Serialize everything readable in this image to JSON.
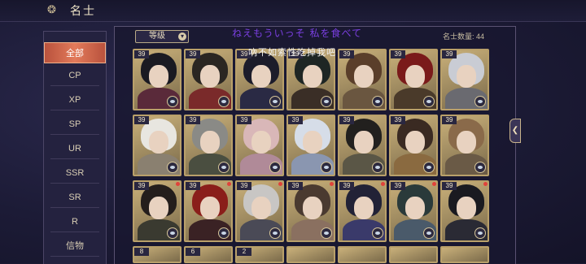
{
  "header": {
    "title": "名士"
  },
  "sidebar": {
    "items": [
      {
        "label": "全部",
        "selected": true
      },
      {
        "label": "CP"
      },
      {
        "label": "XP"
      },
      {
        "label": "SP"
      },
      {
        "label": "UR"
      },
      {
        "label": "SSR"
      },
      {
        "label": "SR"
      },
      {
        "label": "R"
      },
      {
        "label": "信物"
      }
    ]
  },
  "sort": {
    "label": "等级"
  },
  "overlay": {
    "line1": "ねえもういっそ 私を食べて",
    "line2": "吶不如索性吃掉我吧"
  },
  "count": {
    "label": "名士数量: 44"
  },
  "cards": [
    {
      "level": "39",
      "hair": "#1a1a22",
      "body": "#5a2a3a",
      "badge": "eye-icon"
    },
    {
      "level": "39",
      "hair": "#2a2622",
      "body": "#7a2a2a",
      "badge": "eye-icon"
    },
    {
      "level": "39",
      "hair": "#1c1c2a",
      "body": "#2a2a44",
      "badge": "eye-icon"
    },
    {
      "level": "39",
      "hair": "#1e2624",
      "body": "#3a2e26",
      "badge": "eye-icon"
    },
    {
      "level": "39",
      "hair": "#5a3e2a",
      "body": "#6a5640",
      "badge": "eye-icon"
    },
    {
      "level": "39",
      "hair": "#7a1a1a",
      "body": "#4a3a2a",
      "badge": "eye-icon"
    },
    {
      "level": "39",
      "hair": "#c9ccd4",
      "body": "#6a6a70",
      "badge": "eye-icon"
    },
    {
      "level": "39",
      "hair": "#e8e6e0",
      "body": "#8a8070",
      "badge": "eye-icon"
    },
    {
      "level": "39",
      "hair": "#8a8a86",
      "body": "#4a4e40",
      "badge": "eye-icon"
    },
    {
      "level": "39",
      "hair": "#d9b7b8",
      "body": "#b08a98",
      "badge": "eye-icon"
    },
    {
      "level": "39",
      "hair": "#d6dde8",
      "body": "#8a96b0",
      "badge": "eye-icon"
    },
    {
      "level": "39",
      "hair": "#22201e",
      "body": "#5a5646",
      "badge": "eye-icon"
    },
    {
      "level": "39",
      "hair": "#3a2a22",
      "body": "#8a6a40",
      "badge": "eye-icon"
    },
    {
      "level": "39",
      "hair": "#8a6a4a",
      "body": "#6a5a46",
      "badge": "eye-icon"
    },
    {
      "level": "39",
      "hair": "#241e1c",
      "body": "#3a3a30",
      "badge": "eye-icon",
      "dot": true
    },
    {
      "level": "39",
      "hair": "#8a1e1a",
      "body": "#3a2224",
      "badge": "eye-icon",
      "dot": true
    },
    {
      "level": "39",
      "hair": "#c8c6c4",
      "body": "#4a4a56",
      "badge": "eye-icon",
      "dot": true
    },
    {
      "level": "39",
      "hair": "#4a3a30",
      "body": "#8a7060",
      "badge": "eye-icon",
      "dot": true
    },
    {
      "level": "39",
      "hair": "#222236",
      "body": "#3a3a6a",
      "badge": "eye-icon",
      "dot": true
    },
    {
      "level": "39",
      "hair": "#2a3a3a",
      "body": "#4a5a6a",
      "badge": "eye-icon",
      "dot": true
    },
    {
      "level": "39",
      "hair": "#1a1a20",
      "body": "#2a2a34",
      "badge": "eye-icon",
      "dot": true
    }
  ],
  "partial_row_levels": [
    "8",
    "6",
    "2",
    "",
    "",
    "",
    ""
  ]
}
